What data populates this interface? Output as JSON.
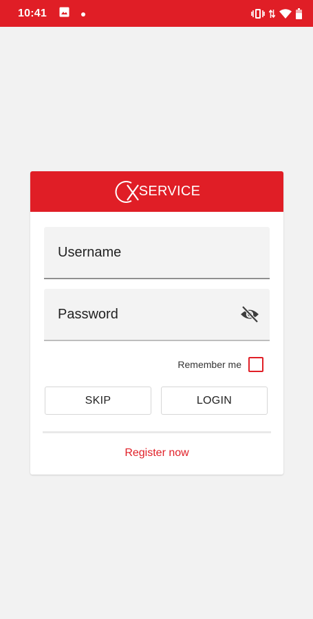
{
  "status_bar": {
    "time": "10:41",
    "icons": [
      "image-icon",
      "dot-icon",
      "vibrate-icon",
      "data-arrows-icon",
      "wifi-icon",
      "battery-icon"
    ]
  },
  "brand": {
    "logo_text": "SERVICE",
    "color": "#e01e26"
  },
  "login_form": {
    "username_label": "Username",
    "password_label": "Password",
    "remember_label": "Remember me",
    "skip_label": "SKIP",
    "login_label": "LOGIN",
    "register_label": "Register now"
  }
}
